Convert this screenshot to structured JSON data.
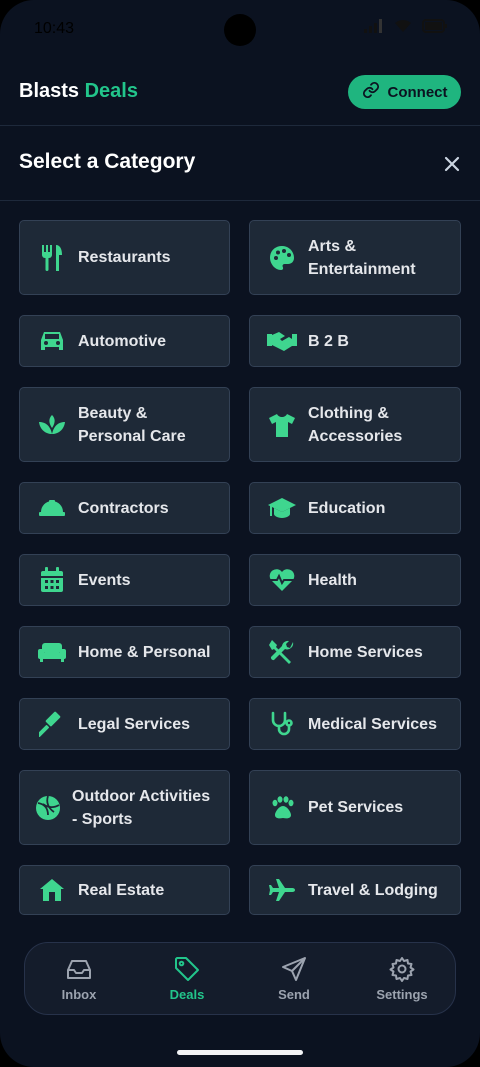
{
  "status": {
    "time": "10:43"
  },
  "header": {
    "brand_main": "Blasts",
    "brand_accent": "Deals",
    "connect_label": "Connect"
  },
  "modal": {
    "title": "Select a Category"
  },
  "categories": [
    {
      "label": "Restaurants",
      "icon": "utensils-icon"
    },
    {
      "label": "Arts &\nEntertainment",
      "icon": "palette-icon"
    },
    {
      "label": "Automotive",
      "icon": "car-icon"
    },
    {
      "label": "B 2 B",
      "icon": "handshake-icon"
    },
    {
      "label": "Beauty &\nPersonal Care",
      "icon": "spa-icon"
    },
    {
      "label": "Clothing &\nAccessories",
      "icon": "shirt-icon"
    },
    {
      "label": "Contractors",
      "icon": "hardhat-icon"
    },
    {
      "label": "Education",
      "icon": "graduation-cap-icon"
    },
    {
      "label": "Events",
      "icon": "calendar-icon"
    },
    {
      "label": "Health",
      "icon": "heart-pulse-icon"
    },
    {
      "label": "Home & Personal",
      "icon": "couch-icon"
    },
    {
      "label": "Home Services",
      "icon": "tools-icon"
    },
    {
      "label": "Legal Services",
      "icon": "gavel-icon"
    },
    {
      "label": "Medical Services",
      "icon": "stethoscope-icon"
    },
    {
      "label": "Outdoor Activities\n- Sports",
      "icon": "volleyball-icon"
    },
    {
      "label": "Pet Services",
      "icon": "paw-icon"
    },
    {
      "label": "Real Estate",
      "icon": "house-icon"
    },
    {
      "label": "Travel & Lodging",
      "icon": "plane-icon"
    }
  ],
  "nav": [
    {
      "label": "Inbox",
      "icon": "inbox-icon"
    },
    {
      "label": "Deals",
      "icon": "tag-icon"
    },
    {
      "label": "Send",
      "icon": "send-icon"
    },
    {
      "label": "Settings",
      "icon": "settings-icon"
    }
  ],
  "colors": {
    "accent": "#22c58b",
    "background": "#0b1220",
    "tile": "#1e2937"
  }
}
